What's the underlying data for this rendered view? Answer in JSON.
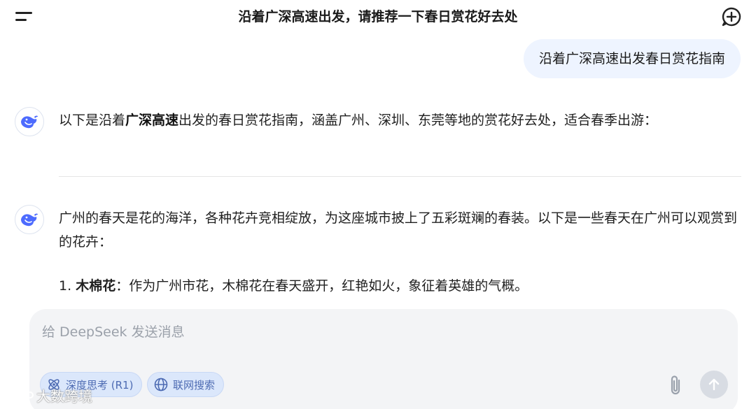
{
  "header": {
    "title": "沿着广深高速出发，请推荐一下春日赏花好去处"
  },
  "user_message": "沿着广深高速出发春日赏花指南",
  "assistant_messages": [
    {
      "intro": "以下是沿着",
      "bold": "广深高速",
      "rest": "出发的春日赏花指南，涵盖广州、深圳、东莞等地的赏花好去处，适合春季出游："
    },
    {
      "text": "广州的春天是花的海洋，各种花卉竞相绽放，为这座城市披上了五彩斑斓的春装。以下是一些春天在广州可以观赏到的花卉：",
      "list": [
        {
          "number": "1.",
          "name": "木棉花",
          "desc": "：作为广州市花，木棉花在春天盛开，红艳如火，象征着英雄的气概。"
        }
      ]
    }
  ],
  "composer": {
    "placeholder": "给 DeepSeek 发送消息",
    "chips": [
      {
        "label": "深度思考 (R1)",
        "icon": "atom-icon"
      },
      {
        "label": "联网搜索",
        "icon": "globe-icon"
      }
    ],
    "attach_icon": "paperclip-icon",
    "send_icon": "arrow-up-icon"
  },
  "watermark": {
    "text": "大数跨境"
  },
  "colors": {
    "user_bubble": "#eef4ff",
    "composer_bg": "#f3f4f6",
    "chip_bg": "#dbe7fb",
    "chip_text": "#4d6bb3",
    "brand_blue": "#4d6bfe"
  }
}
